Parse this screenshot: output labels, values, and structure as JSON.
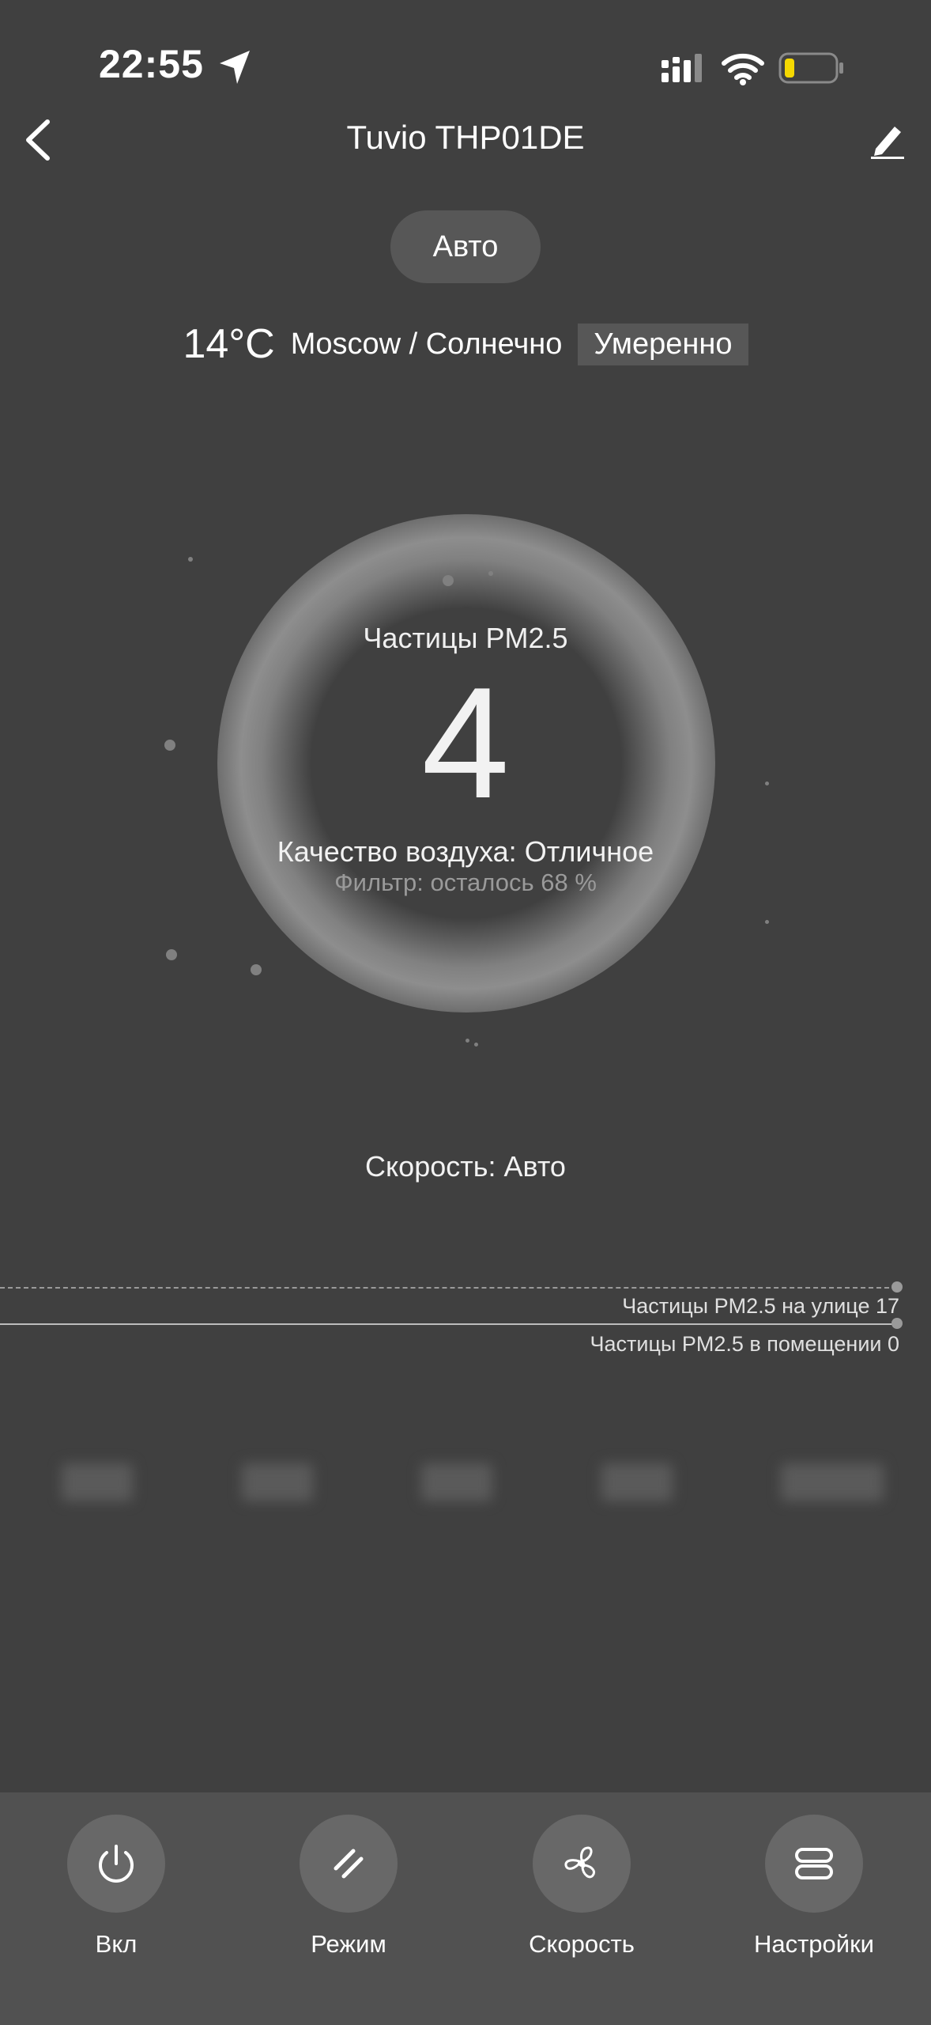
{
  "status_bar": {
    "time": "22:55"
  },
  "header": {
    "title": "Tuvio THP01DE"
  },
  "mode": {
    "label": "Авто"
  },
  "weather": {
    "temperature": "14°C",
    "location_condition": "Moscow / Солнечно",
    "air_badge": "Умеренно"
  },
  "air": {
    "label": "Частицы PM2.5",
    "value": "4",
    "quality": "Качество воздуха: Отличное",
    "filter": "Фильтр: осталось 68 %"
  },
  "fan": {
    "speed": "Скорость: Авто"
  },
  "graph": {
    "outdoor_label": "Частицы PM2.5 на улице 17",
    "indoor_label": "Частицы PM2.5 в помещении 0"
  },
  "bottom_bar": {
    "items": [
      {
        "label": "Вкл",
        "icon": "power-icon"
      },
      {
        "label": "Режим",
        "icon": "mode-icon"
      },
      {
        "label": "Скорость",
        "icon": "fan-icon"
      },
      {
        "label": "Настройки",
        "icon": "settings-icon"
      }
    ]
  },
  "colors": {
    "background": "#404040",
    "bottom_bar": "#515151",
    "button": "#686868",
    "battery_level": "#f5d800"
  }
}
